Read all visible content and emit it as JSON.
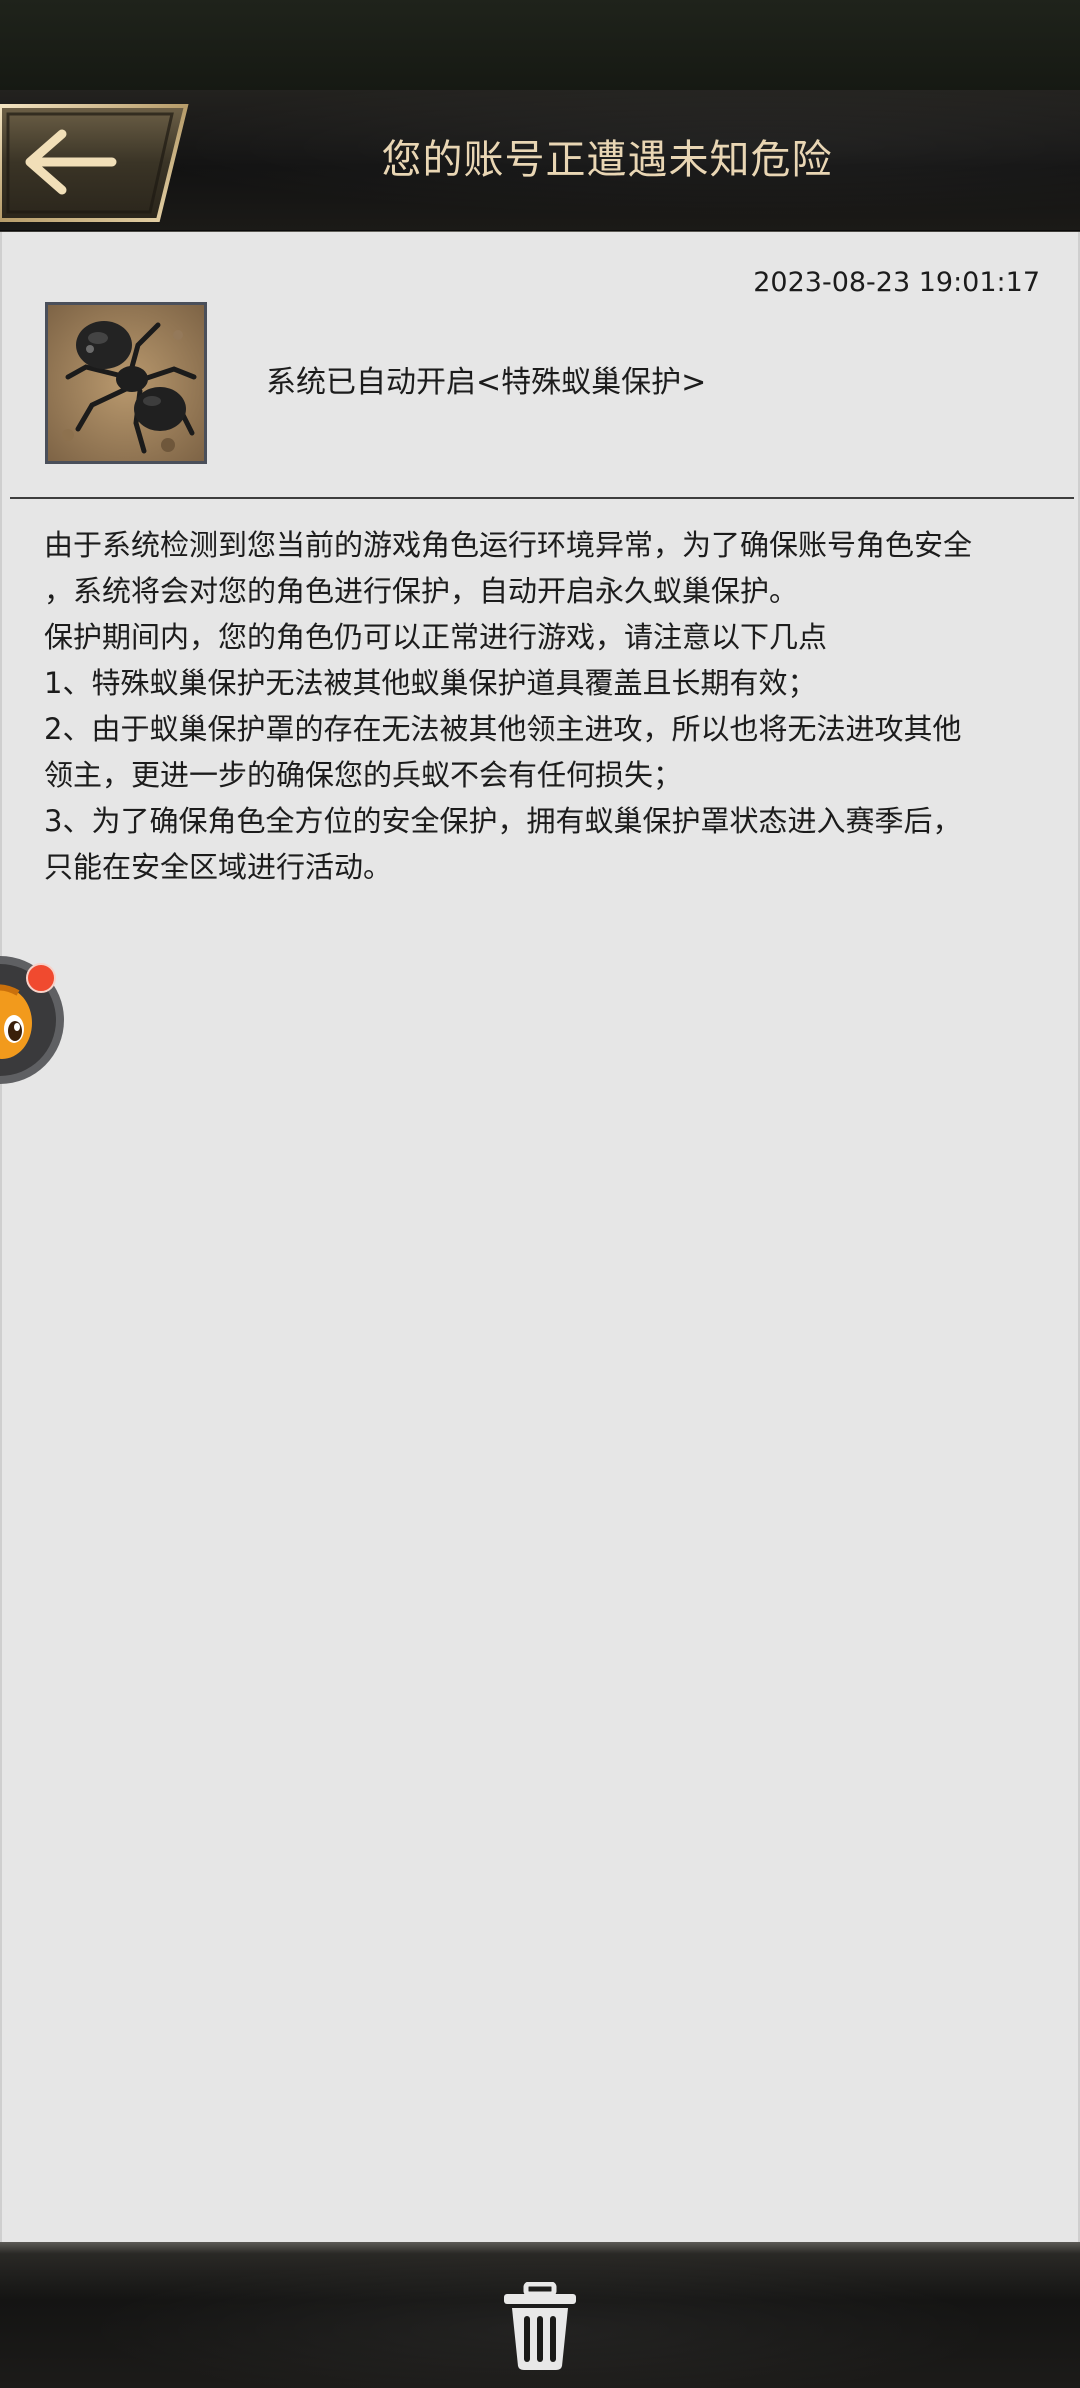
{
  "header": {
    "title": "您的账号正遭遇未知危险",
    "back_icon": "back-arrow-icon",
    "accent_color": "#e9d6b4"
  },
  "message": {
    "timestamp": "2023-08-23 19:01:17",
    "avatar_icon": "ant-avatar-icon",
    "subject": "系统已自动开启<特殊蚁巢保护>",
    "body_lines": [
      "由于系统检测到您当前的游戏角色运行环境异常，为了确保账号角色安全",
      "，系统将会对您的角色进行保护，自动开启永久蚁巢保护。",
      "保护期间内，您的角色仍可以正常进行游戏，请注意以下几点",
      "1、特殊蚁巢保护无法被其他蚁巢保护道具覆盖且长期有效；",
      "2、由于蚁巢保护罩的存在无法被其他领主进攻，所以也将无法进攻其他",
      "领主，更进一步的确保您的兵蚁不会有任何损失；",
      "3、为了确保角色全方位的安全保护，拥有蚁巢保护罩状态进入赛季后，",
      "只能在安全区域进行活动。"
    ]
  },
  "floating_widget": {
    "icon": "assistant-mascot-icon",
    "badge_color": "#f04a2f"
  },
  "footer": {
    "delete_icon": "trash-icon"
  }
}
